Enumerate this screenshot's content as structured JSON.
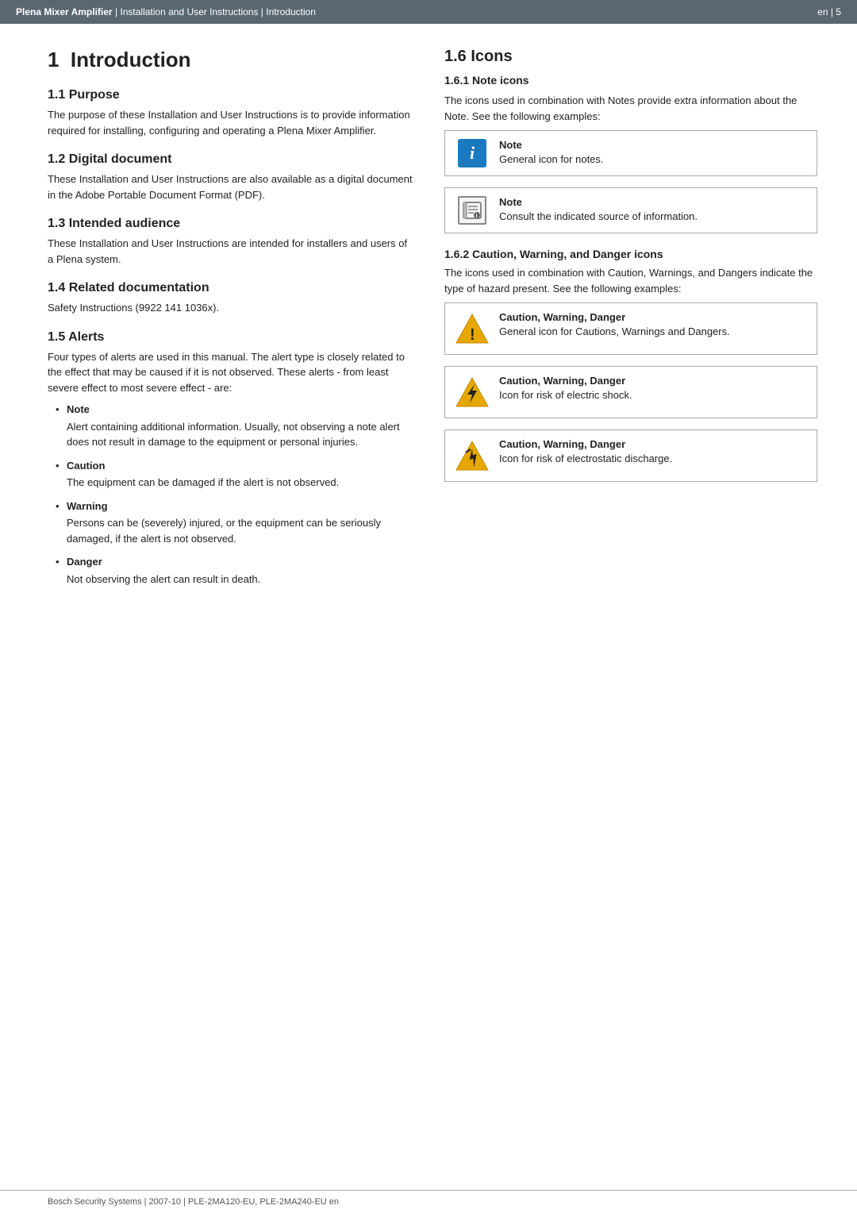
{
  "header": {
    "product": "Plena Mixer Amplifier",
    "subtitle": "Installation and User Instructions | Introduction",
    "lang": "en",
    "page": "5"
  },
  "chapter": {
    "number": "1",
    "title": "Introduction"
  },
  "sections": {
    "left": [
      {
        "id": "1.1",
        "title": "1.1   Purpose",
        "body": "The purpose of these Installation and User Instructions is to provide information required for installing, configuring and operating a Plena Mixer Amplifier."
      },
      {
        "id": "1.2",
        "title": "1.2   Digital document",
        "body": "These Installation and User Instructions are also available as a digital document in the Adobe Portable Document Format (PDF)."
      },
      {
        "id": "1.3",
        "title": "1.3   Intended audience",
        "body": "These Installation and User Instructions are intended for installers and users of a Plena system."
      },
      {
        "id": "1.4",
        "title": "1.4   Related documentation",
        "body": "Safety Instructions (9922 141 1036x)."
      },
      {
        "id": "1.5",
        "title": "1.5   Alerts",
        "intro": "Four types of alerts are used in this manual. The alert type is closely related to the effect that may be caused if it is not observed. These alerts - from least severe effect to most severe effect - are:",
        "alerts": [
          {
            "term": "Note",
            "desc": "Alert containing additional information. Usually, not observing a note alert does not result in damage to the equipment or personal injuries."
          },
          {
            "term": "Caution",
            "desc": "The equipment can be damaged if the alert is not observed."
          },
          {
            "term": "Warning",
            "desc": "Persons can be (severely) injured, or the equipment can be seriously damaged, if the alert is not observed."
          },
          {
            "term": "Danger",
            "desc": "Not observing the alert can result in death."
          }
        ]
      }
    ],
    "right": {
      "id": "1.6",
      "title": "1.6   Icons",
      "subsections": [
        {
          "id": "1.6.1",
          "title": "1.6.1   Note icons",
          "intro": "The icons used in combination with Notes provide extra information about the Note. See the following examples:",
          "icons": [
            {
              "type": "note-blue",
              "label": "Note",
              "desc": "General icon for notes."
            },
            {
              "type": "note-book",
              "label": "Note",
              "desc": "Consult the indicated source of information."
            }
          ]
        },
        {
          "id": "1.6.2",
          "title": "1.6.2   Caution, Warning, and Danger icons",
          "intro": "The icons used in combination with Caution, Warnings, and Dangers indicate the type of hazard present. See the following examples:",
          "icons": [
            {
              "type": "warn-general",
              "label": "Caution, Warning, Danger",
              "desc": "General icon for Cautions, Warnings and Dangers."
            },
            {
              "type": "warn-lightning",
              "label": "Caution, Warning, Danger",
              "desc": "Icon for risk of electric shock."
            },
            {
              "type": "warn-esd",
              "label": "Caution, Warning, Danger",
              "desc": "Icon for risk of electrostatic discharge."
            }
          ]
        }
      ]
    }
  },
  "footer": {
    "text": "Bosch Security Systems | 2007-10 | PLE-2MA120-EU,  PLE-2MA240-EU en"
  }
}
